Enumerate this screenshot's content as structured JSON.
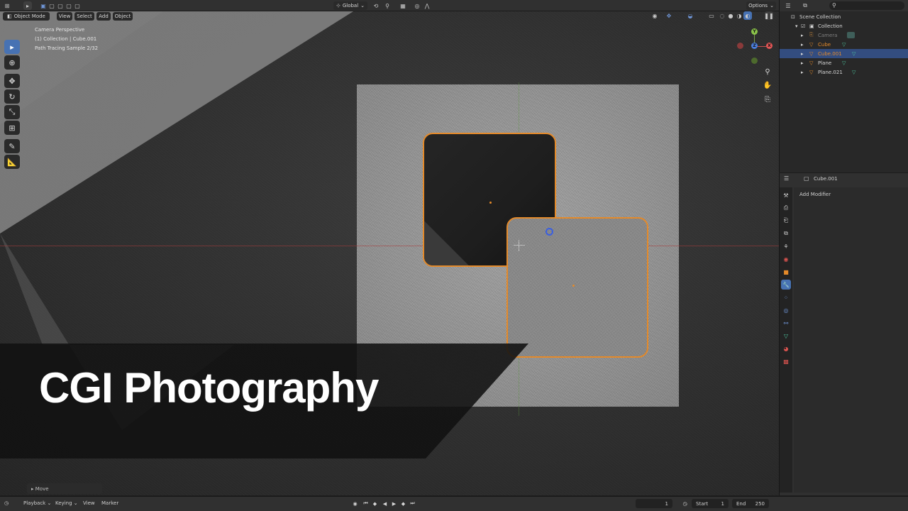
{
  "header": {
    "mode_label": "Object Mode",
    "menus": [
      "View",
      "Select",
      "Add",
      "Object"
    ],
    "transform_orientation": "Global",
    "options_label": "Options"
  },
  "overlay": {
    "view_name": "Camera Perspective",
    "collection_info": "(1) Collection | Cube.001",
    "render_status": "Path Tracing Sample 2/32"
  },
  "gizmo": {
    "y_label": "Y",
    "z_label": "Z",
    "x_label": "X"
  },
  "banner": {
    "title": "CGI Photography"
  },
  "operator_panel": {
    "label": "Move"
  },
  "outliner": {
    "root": "Scene Collection",
    "collection": "Collection",
    "items": [
      {
        "label": "Camera",
        "color": "#7f7f7f"
      },
      {
        "label": "Cube",
        "color": "#e48a2a"
      },
      {
        "label": "Cube.001",
        "color": "#e48a2a"
      },
      {
        "label": "Plane",
        "color": "#d5d5d5"
      },
      {
        "label": "Plane.021",
        "color": "#d5d5d5"
      }
    ]
  },
  "properties": {
    "object_name": "Cube.001",
    "add_modifier_label": "Add Modifier"
  },
  "timeline": {
    "playback_label": "Playback",
    "keying_label": "Keying",
    "view_label": "View",
    "marker_label": "Marker",
    "current_frame": "1",
    "start_label": "Start",
    "start_value": "1",
    "end_label": "End",
    "end_value": "250"
  },
  "colors": {
    "accent_blue": "#4772b3",
    "selection_orange": "#e48a2a",
    "selected_row": "#334d80"
  }
}
